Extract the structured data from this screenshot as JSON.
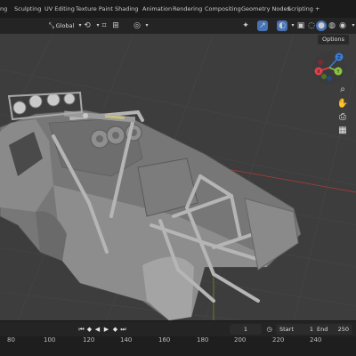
{
  "workspace_tabs": [
    "ng",
    "Sculpting",
    "UV Editing",
    "Texture Paint",
    "Shading",
    "Animation",
    "Rendering",
    "Compositing",
    "Geometry Nodes",
    "Scripting",
    "+"
  ],
  "header": {
    "transform_orientation": "Global",
    "options_label": "Options"
  },
  "gizmo": {
    "x_label": "X",
    "y_label": "Y",
    "z_label": "Z"
  },
  "timeline": {
    "current_frame": "1",
    "start_label": "Start",
    "start_value": "1",
    "end_label": "End",
    "end_value": "250"
  },
  "ruler_ticks": [
    "80",
    "100",
    "120",
    "140",
    "160",
    "180",
    "200",
    "220",
    "240"
  ],
  "colors": {
    "accent": "#4772b3",
    "x_axis": "#e0424a",
    "y_axis": "#8bc53f",
    "z_axis": "#3b7bd4"
  }
}
